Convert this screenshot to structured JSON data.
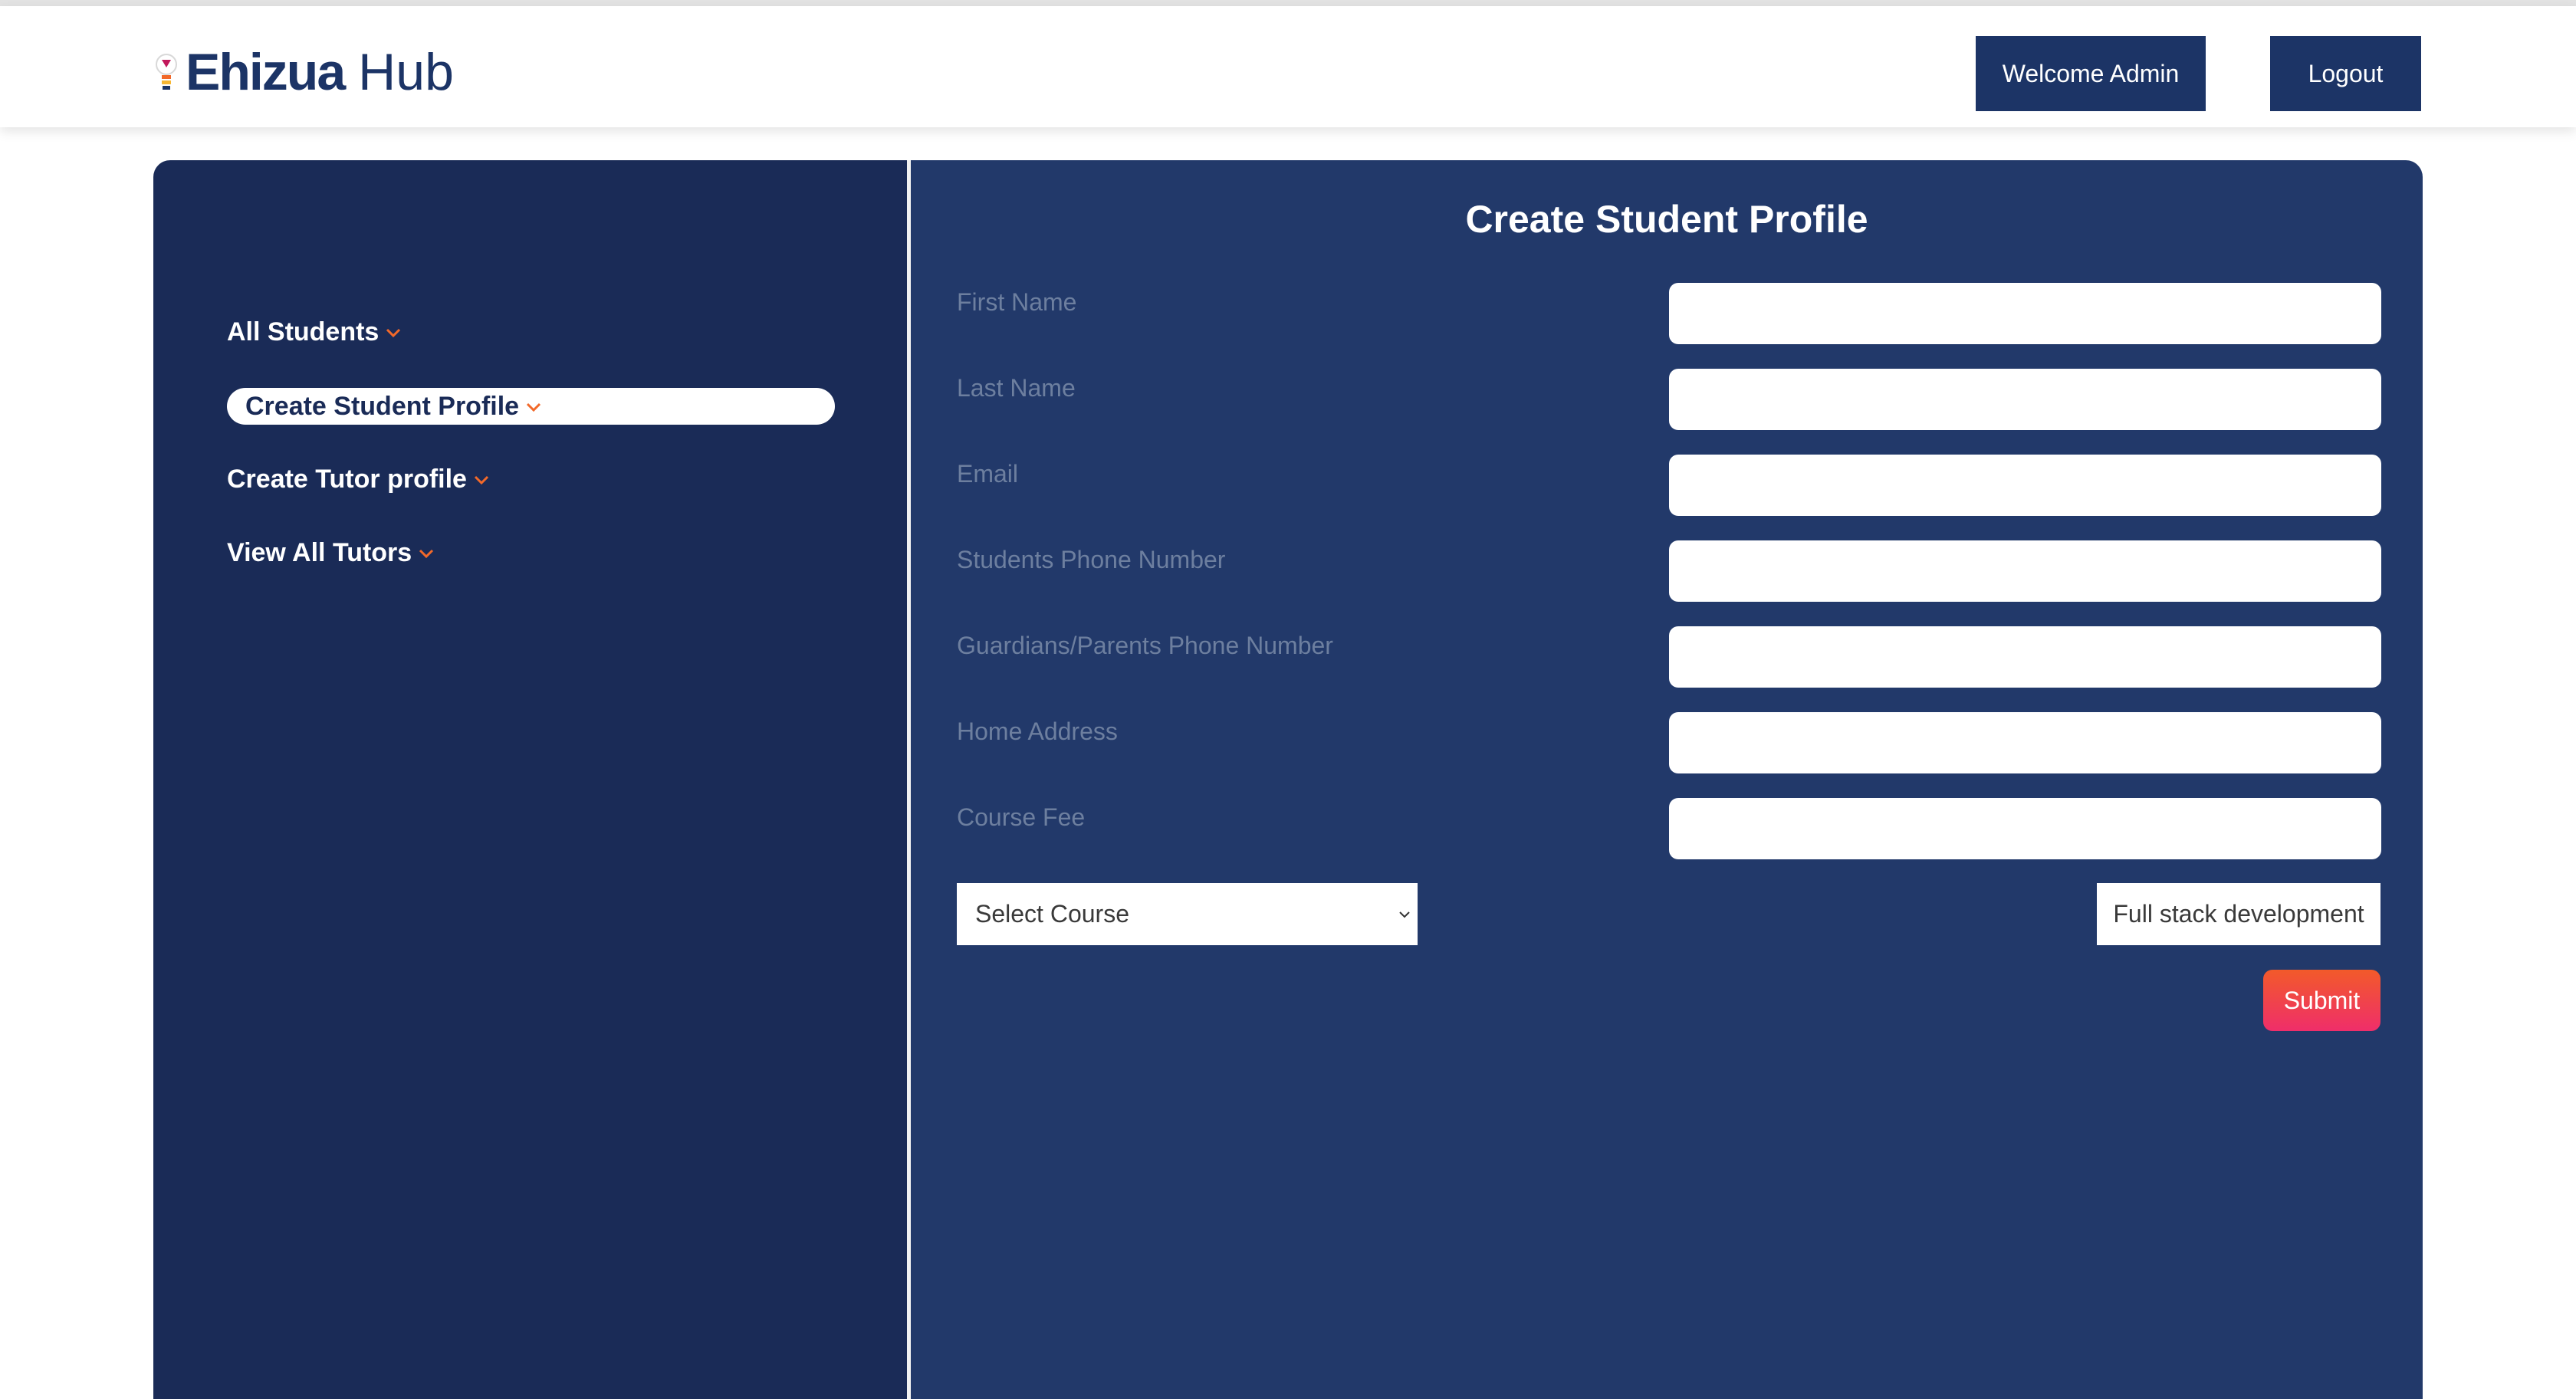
{
  "header": {
    "logo_bold": "Ehizua",
    "logo_light": "Hub",
    "welcome_label": "Welcome Admin",
    "logout_label": "Logout"
  },
  "sidebar": {
    "items": [
      {
        "label": "All Students",
        "icon": "chevron-down-icon",
        "active": false
      },
      {
        "label": "Create Student Profile",
        "icon": "chevron-down-icon",
        "active": true
      },
      {
        "label": "Create Tutor profile",
        "icon": "chevron-down-icon",
        "active": false
      },
      {
        "label": "View All Tutors",
        "icon": "chevron-down-icon",
        "active": false
      }
    ]
  },
  "form": {
    "title": "Create Student Profile",
    "fields": [
      {
        "label": "First Name",
        "value": ""
      },
      {
        "label": "Last Name",
        "value": ""
      },
      {
        "label": "Email",
        "value": ""
      },
      {
        "label": "Students Phone Number",
        "value": ""
      },
      {
        "label": "Guardians/Parents Phone Number",
        "value": ""
      },
      {
        "label": "Home Address",
        "value": ""
      },
      {
        "label": "Course Fee",
        "value": ""
      }
    ],
    "select_course": "Select Course",
    "selected_course_display": "Full stack development",
    "submit_label": "Submit"
  },
  "colors": {
    "brand_navy": "#1c3466",
    "sidebar_bg": "#1a2b57",
    "main_bg": "#22396a",
    "accent_orange": "#f2692a",
    "submit_gradient_start": "#f25a2a",
    "submit_gradient_end": "#ef2e6a"
  }
}
